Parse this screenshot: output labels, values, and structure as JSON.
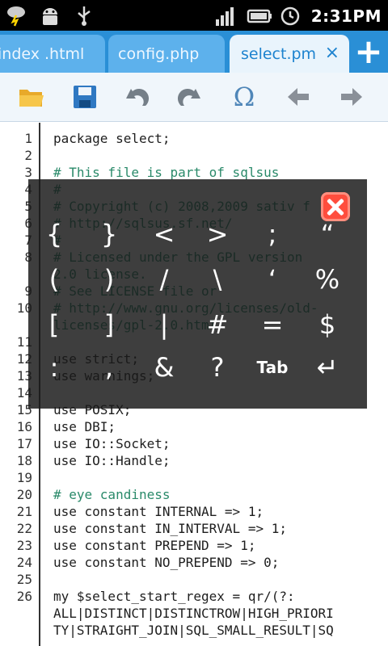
{
  "status_bar": {
    "time": "2:31PM",
    "icons": [
      "weather-storm-icon",
      "android-debug-icon",
      "usb-icon",
      "signal-icon",
      "battery-icon",
      "alarm-icon"
    ]
  },
  "tabs": [
    {
      "label": "index .html",
      "active": false
    },
    {
      "label": "config.php",
      "active": false
    },
    {
      "label": "select.pm",
      "active": true
    }
  ],
  "tab_close_glyph": "×",
  "add_tab_glyph": "+",
  "toolbar": {
    "icons": [
      "open-folder-icon",
      "save-icon",
      "undo-icon",
      "redo-icon",
      "omega-symbols-icon",
      "back-arrow-icon",
      "forward-arrow-icon"
    ],
    "omega_glyph": "Ω"
  },
  "lines": [
    {
      "n": "1",
      "text": "package select;",
      "style": "keyword"
    },
    {
      "n": "2",
      "text": "",
      "style": "keyword"
    },
    {
      "n": "3",
      "text": "# This file is part of sqlsus",
      "style": "comment"
    },
    {
      "n": "4",
      "text": "#",
      "style": "comment"
    },
    {
      "n": "5",
      "text": "# Copyright (c) 2008,2009 sativ f",
      "style": "comment"
    },
    {
      "n": "6",
      "text": "# http://sqlsus.sf.net/",
      "style": "comment"
    },
    {
      "n": "7",
      "text": "#",
      "style": "comment"
    },
    {
      "n": "8",
      "text": "# Licensed under the GPL version",
      "style": "comment"
    },
    {
      "n": "",
      "text": "2.0 license.",
      "style": "comment"
    },
    {
      "n": "9",
      "text": "# See LICENSE file or",
      "style": "comment"
    },
    {
      "n": "10",
      "text": "# http://www.gnu.org/licenses/old-",
      "style": "comment"
    },
    {
      "n": "",
      "text": "licenses/gpl-2.0.html",
      "style": "comment"
    },
    {
      "n": "11",
      "text": "",
      "style": "keyword"
    },
    {
      "n": "12",
      "text": "use strict;",
      "style": "keyword"
    },
    {
      "n": "13",
      "text": "use warnings;",
      "style": "keyword"
    },
    {
      "n": "14",
      "text": "",
      "style": "keyword"
    },
    {
      "n": "15",
      "text": "use POSIX;",
      "style": "keyword"
    },
    {
      "n": "16",
      "text": "use DBI;",
      "style": "keyword"
    },
    {
      "n": "17",
      "text": "use IO::Socket;",
      "style": "keyword"
    },
    {
      "n": "18",
      "text": "use IO::Handle;",
      "style": "keyword"
    },
    {
      "n": "19",
      "text": "",
      "style": "keyword"
    },
    {
      "n": "20",
      "text": "# eye candiness",
      "style": "comment"
    },
    {
      "n": "21",
      "text": "use constant INTERNAL => 1;",
      "style": "keyword"
    },
    {
      "n": "22",
      "text": "use constant IN_INTERVAL => 1;",
      "style": "keyword"
    },
    {
      "n": "23",
      "text": "use constant PREPEND => 1;",
      "style": "keyword"
    },
    {
      "n": "24",
      "text": "use constant NO_PREPEND => 0;",
      "style": "keyword"
    },
    {
      "n": "25",
      "text": "",
      "style": "keyword"
    },
    {
      "n": "26",
      "text": "my $select_start_regex = qr/(?:",
      "style": "keyword"
    },
    {
      "n": "",
      "text": "ALL|DISTINCT|DISTINCTROW|HIGH_PRIORI",
      "style": "keyword"
    },
    {
      "n": "",
      "text": "TY|STRAIGHT_JOIN|SQL_SMALL_RESULT|SQ",
      "style": "keyword"
    }
  ],
  "symbol_panel": {
    "rows": [
      [
        "{",
        "}",
        "<",
        ">",
        ";",
        "“"
      ],
      [
        "(",
        ")",
        "/",
        "\\",
        "‘",
        "%"
      ],
      [
        "[",
        "]",
        "|",
        "#",
        "=",
        "$"
      ],
      [
        ":",
        ",",
        "&",
        "?",
        "Tab",
        "↵"
      ]
    ]
  }
}
